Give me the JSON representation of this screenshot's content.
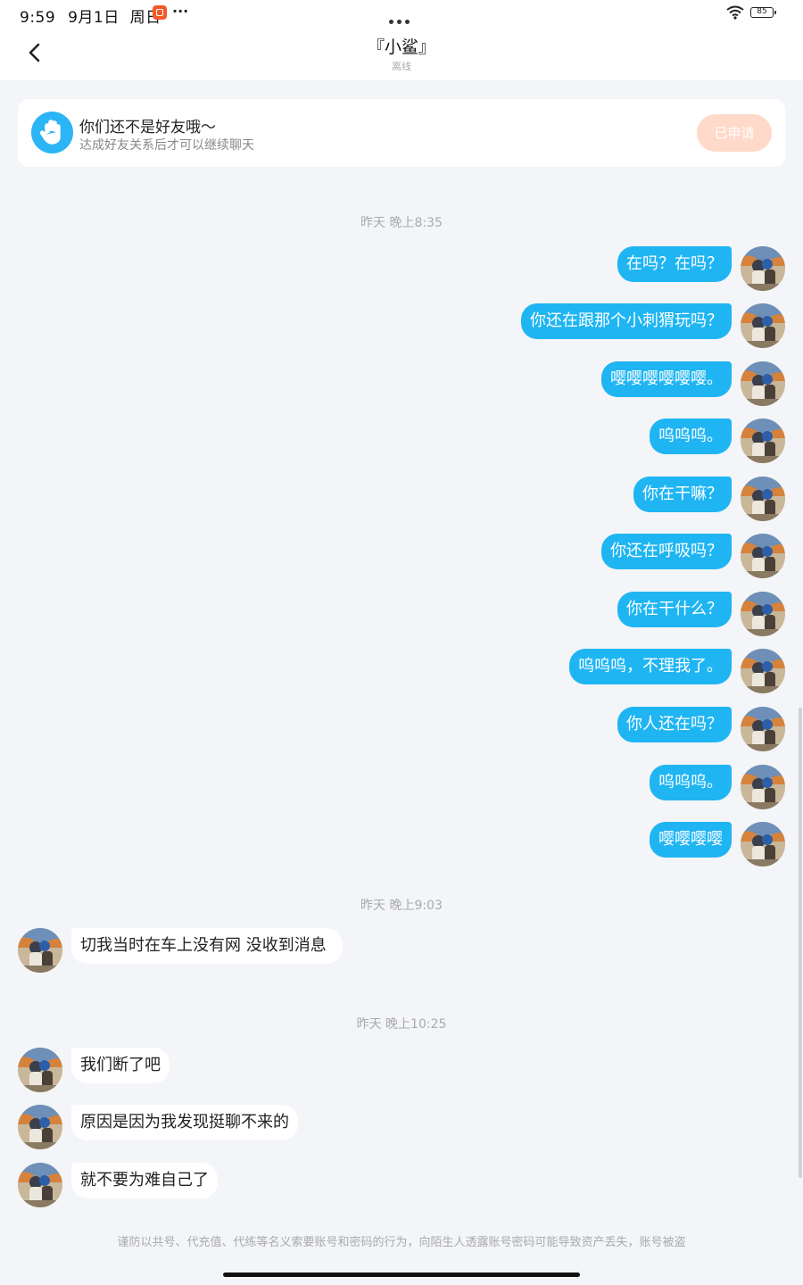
{
  "status_bar": {
    "time": "9:59",
    "date": "9月1日",
    "weekday": "周日",
    "more": "···",
    "battery": "85"
  },
  "header": {
    "title": "『小鲨』",
    "subtitle": "离线"
  },
  "banner": {
    "title": "你们还不是好友哦～",
    "subtitle": "达成好友关系后才可以继续聊天",
    "button_label": "已申请"
  },
  "timestamps": {
    "t1": "昨天 晚上8:35",
    "t2": "昨天 晚上9:03",
    "t3": "昨天 晚上10:25"
  },
  "outgoing": [
    "在吗？在吗？",
    "你还在跟那个小刺猬玩吗？",
    "嘤嘤嘤嘤嘤嘤。",
    "呜呜呜。",
    "你在干嘛？",
    "你还在呼吸吗？",
    "你在干什么？",
    "呜呜呜，不理我了。",
    "你人还在吗？",
    "呜呜呜。",
    "嘤嘤嘤嘤"
  ],
  "incoming": [
    "切我当时在车上没有网 没收到消息",
    "我们断了吧",
    "原因是因为我发现挺聊不来的",
    "就不要为难自己了"
  ],
  "warning": "谨防以共号、代充值、代练等名义索要账号和密码的行为，向陌生人透露账号密码可能导致资产丢失，账号被盗",
  "colors": {
    "accent": "#1fb5f3",
    "background": "#f3f5f8",
    "applied_button": "#ffd9c9"
  }
}
